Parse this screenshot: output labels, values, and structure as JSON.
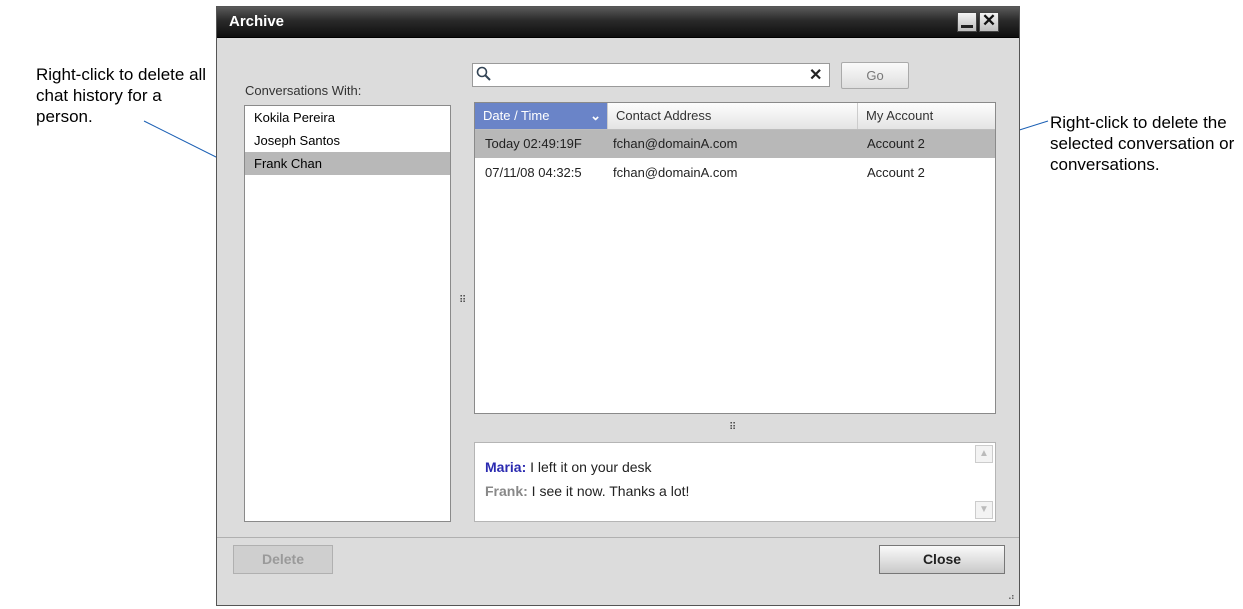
{
  "annotations": {
    "left_callout": "Right-click to delete all chat history for a person.",
    "right_callout": "Right-click to delete the selected conversation or conversations."
  },
  "window": {
    "title": "Archive"
  },
  "conversations": {
    "label": "Conversations With:",
    "items": [
      {
        "name": "Kokila Pereira",
        "selected": false
      },
      {
        "name": "Joseph Santos",
        "selected": false
      },
      {
        "name": "Frank Chan",
        "selected": true
      }
    ]
  },
  "search": {
    "value": "",
    "placeholder": "",
    "go_label": "Go"
  },
  "grid": {
    "columns": [
      "Date / Time",
      "Contact Address",
      "My Account"
    ],
    "rows": [
      {
        "date": "Today 02:49:19F",
        "contact": "fchan@domainA.com",
        "account": "Account 2",
        "selected": true
      },
      {
        "date": "07/11/08 04:32:5",
        "contact": "fchan@domainA.com",
        "account": "Account 2",
        "selected": false
      }
    ]
  },
  "chat": {
    "lines": [
      {
        "speaker": "Maria:",
        "text": " I left it on your desk"
      },
      {
        "speaker": "Frank:",
        "text": " I see it now. Thanks a lot!"
      }
    ]
  },
  "buttons": {
    "delete": "Delete",
    "close": "Close"
  },
  "colors": {
    "title_bar": "#1a1a1a",
    "header_sorted": "#6a84c8",
    "selection": "#b8b8b8",
    "maria_name": "#2a2ab0",
    "frank_name": "#888888"
  }
}
